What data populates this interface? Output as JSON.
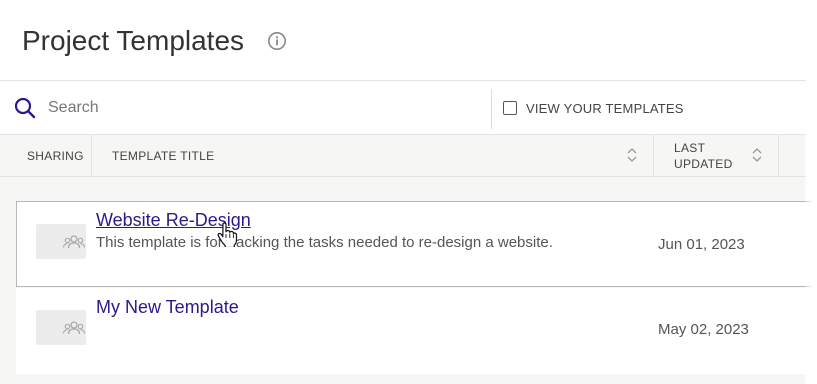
{
  "header": {
    "title": "Project Templates",
    "info_icon": "info-circle-icon"
  },
  "toolbar": {
    "search_icon": "search-icon",
    "search_placeholder": "Search",
    "search_value": "",
    "view_your_templates_label": "VIEW YOUR TEMPLATES",
    "view_your_templates_checked": false
  },
  "table": {
    "columns": {
      "sharing": "SHARING",
      "template_title": "TEMPLATE TITLE",
      "last_updated_line1": "LAST",
      "last_updated_line2": "UPDATED"
    },
    "rows": [
      {
        "title": "Website Re-Design",
        "description": "This template is for tracking the tasks needed to re-design a website.",
        "last_updated": "Jun 01, 2023",
        "sharing_icon": "group-icon",
        "hovered": true
      },
      {
        "title": "My New Template",
        "description": "",
        "last_updated": "May 02, 2023",
        "sharing_icon": "group-icon",
        "hovered": false
      }
    ]
  },
  "colors": {
    "link": "#2c1a8a",
    "search_icon": "#2c1a8a",
    "header_bg": "#f6f6f5"
  }
}
